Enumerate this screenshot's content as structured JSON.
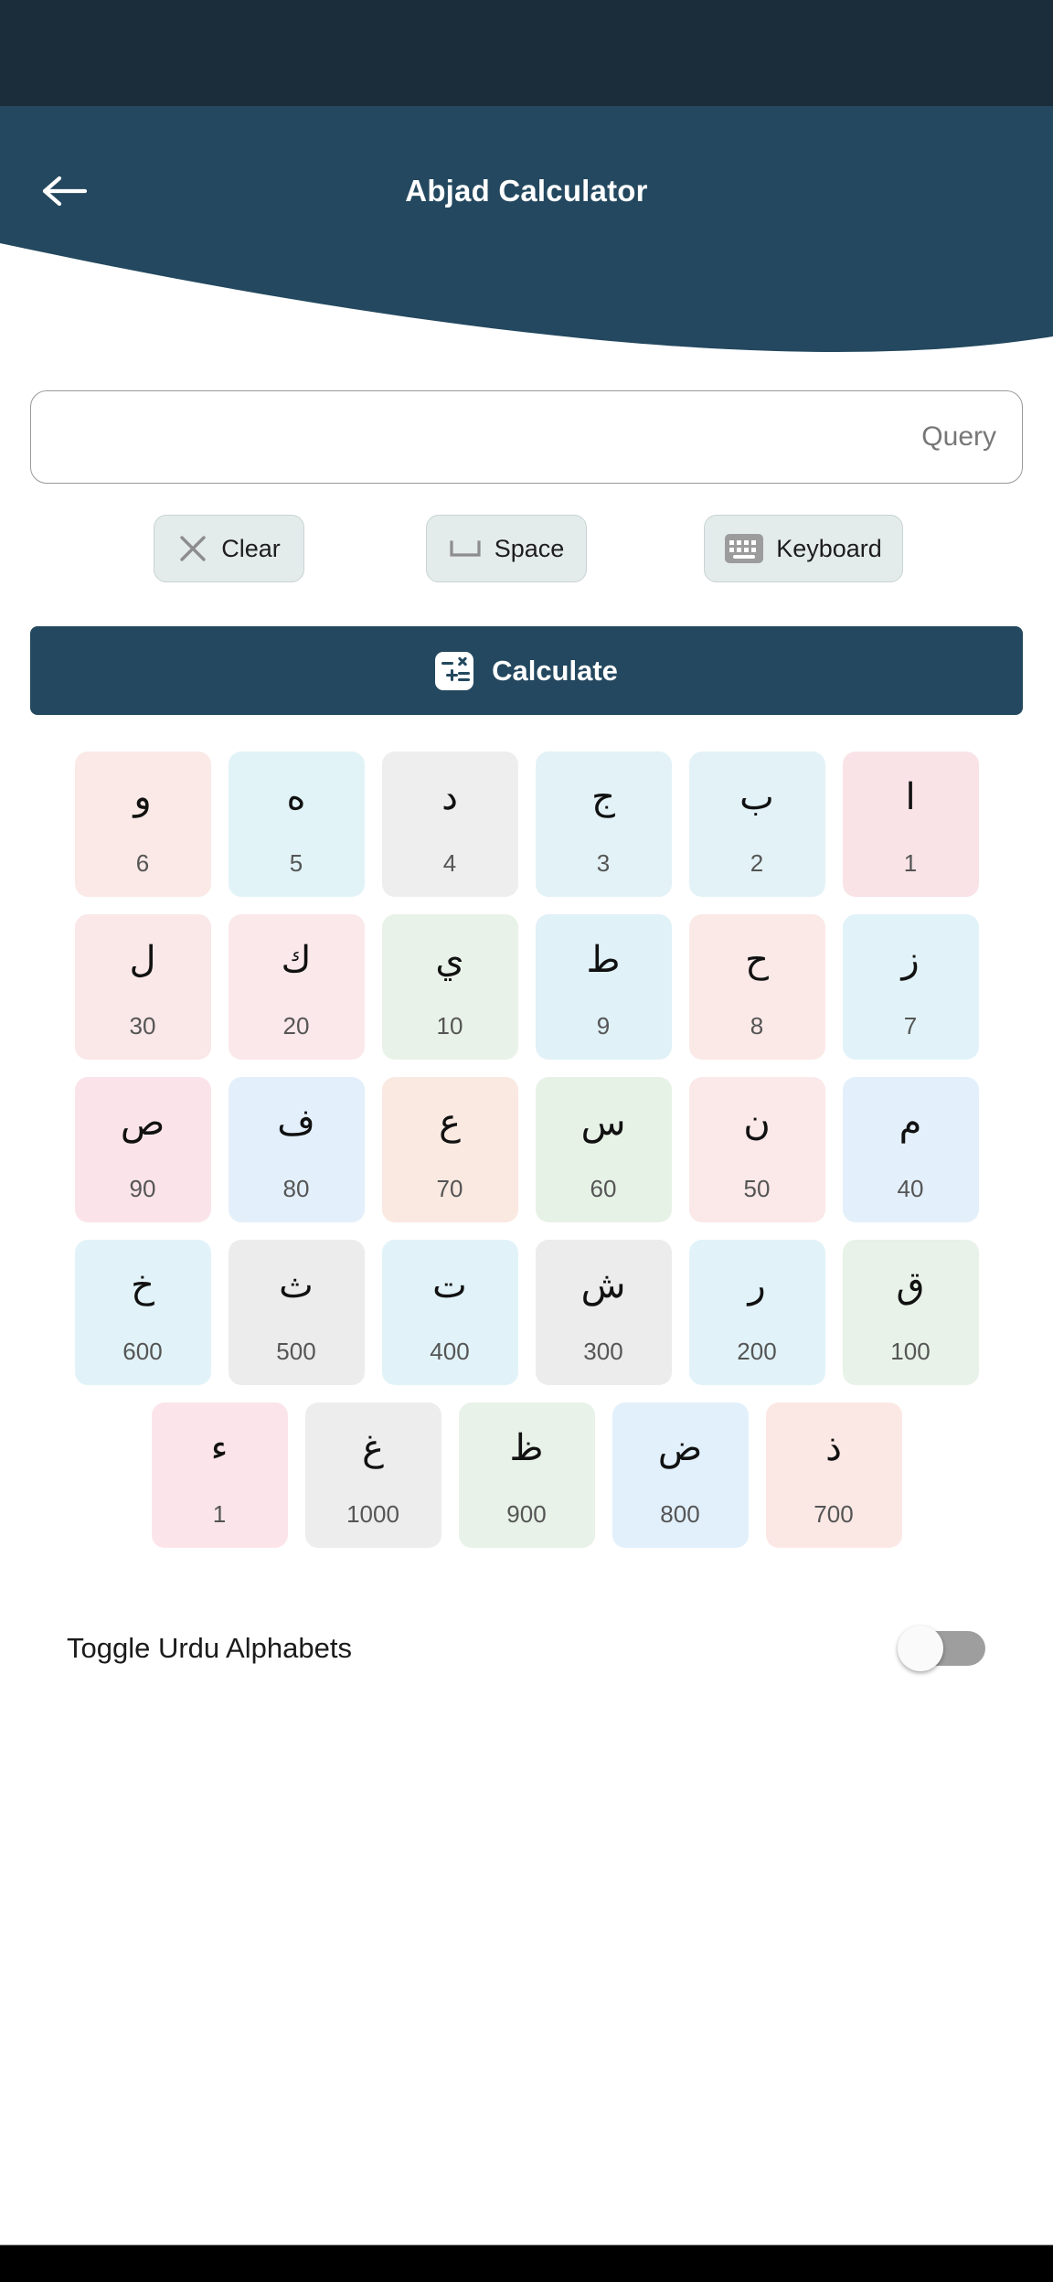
{
  "appbar": {
    "title": "Abjad Calculator",
    "back_icon": "arrow-left-icon",
    "bg_color": "#23485f",
    "status_bar_color": "#1b2d3a"
  },
  "search": {
    "placeholder": "Query",
    "value": ""
  },
  "actions": [
    {
      "id": "clear",
      "label": "Clear",
      "icon": "close-x-icon"
    },
    {
      "id": "space",
      "label": "Space",
      "icon": "space-bar-icon"
    },
    {
      "id": "keyboard",
      "label": "Keyboard",
      "icon": "keyboard-icon"
    }
  ],
  "calculate": {
    "label": "Calculate",
    "icon": "calculator-icon"
  },
  "grid": {
    "rows": [
      [
        {
          "letter": "و",
          "value": "6",
          "color": "#fae9e6"
        },
        {
          "letter": "ه",
          "value": "5",
          "color": "#e1f3f7"
        },
        {
          "letter": "د",
          "value": "4",
          "color": "#eeeeee"
        },
        {
          "letter": "ج",
          "value": "3",
          "color": "#e3f2f6"
        },
        {
          "letter": "ب",
          "value": "2",
          "color": "#e3f2f6"
        },
        {
          "letter": "ا",
          "value": "1",
          "color": "#f9e3e7"
        }
      ],
      [
        {
          "letter": "ل",
          "value": "30",
          "color": "#fae7e8"
        },
        {
          "letter": "ك",
          "value": "20",
          "color": "#fbe8ea"
        },
        {
          "letter": "ي",
          "value": "10",
          "color": "#e9f2e8"
        },
        {
          "letter": "ط",
          "value": "9",
          "color": "#e0f1f7"
        },
        {
          "letter": "ح",
          "value": "8",
          "color": "#fbe9e8"
        },
        {
          "letter": "ز",
          "value": "7",
          "color": "#e1f3f8"
        }
      ],
      [
        {
          "letter": "ص",
          "value": "90",
          "color": "#fae4ea"
        },
        {
          "letter": "ف",
          "value": "80",
          "color": "#e3f0fb"
        },
        {
          "letter": "ع",
          "value": "70",
          "color": "#f9e9e1"
        },
        {
          "letter": "س",
          "value": "60",
          "color": "#e7f2e7"
        },
        {
          "letter": "ن",
          "value": "50",
          "color": "#fbe8e8"
        },
        {
          "letter": "م",
          "value": "40",
          "color": "#e3f0fb"
        }
      ],
      [
        {
          "letter": "خ",
          "value": "600",
          "color": "#e1f3f8"
        },
        {
          "letter": "ث",
          "value": "500",
          "color": "#ececed"
        },
        {
          "letter": "ت",
          "value": "400",
          "color": "#e1f3f8"
        },
        {
          "letter": "ش",
          "value": "300",
          "color": "#ececed"
        },
        {
          "letter": "ر",
          "value": "200",
          "color": "#e1f3f9"
        },
        {
          "letter": "ق",
          "value": "100",
          "color": "#e8f2e8"
        }
      ],
      [
        {
          "letter": "ء",
          "value": "1",
          "color": "#fbe5ea"
        },
        {
          "letter": "غ",
          "value": "1000",
          "color": "#ededee"
        },
        {
          "letter": "ظ",
          "value": "900",
          "color": "#e8f2e8"
        },
        {
          "letter": "ض",
          "value": "800",
          "color": "#e2f0fb"
        },
        {
          "letter": "ذ",
          "value": "700",
          "color": "#fbe8e5"
        }
      ]
    ]
  },
  "toggle": {
    "label": "Toggle Urdu Alphabets",
    "state": "off"
  }
}
